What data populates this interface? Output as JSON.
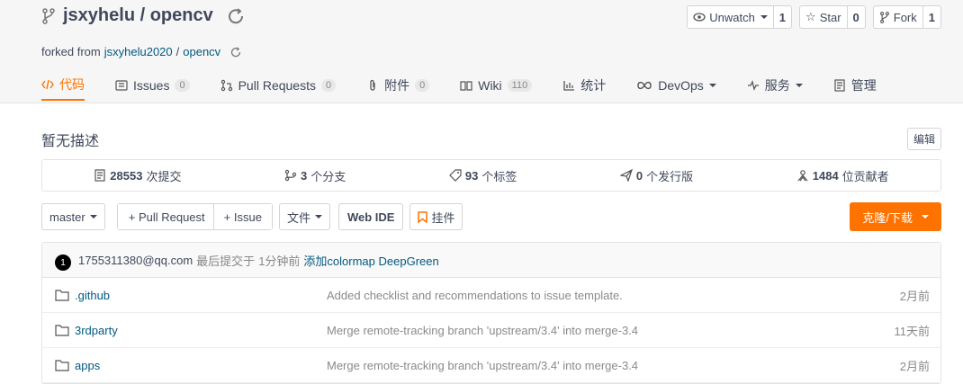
{
  "repo": {
    "title": "jsxyhelu / opencv",
    "forked_prefix": "forked from",
    "forked_owner": "jsxyhelu2020",
    "forked_sep": "/",
    "forked_repo": "opencv"
  },
  "actions": {
    "watch_label": "Unwatch",
    "watch_count": "1",
    "star_label": "Star",
    "star_count": "0",
    "fork_label": "Fork",
    "fork_count": "1"
  },
  "tabs": [
    {
      "label": "代码",
      "count": null
    },
    {
      "label": "Issues",
      "count": "0"
    },
    {
      "label": "Pull Requests",
      "count": "0"
    },
    {
      "label": "附件",
      "count": "0"
    },
    {
      "label": "Wiki",
      "count": "110"
    },
    {
      "label": "统计",
      "count": null
    },
    {
      "label": "DevOps",
      "count": null
    },
    {
      "label": "服务",
      "count": null
    },
    {
      "label": "管理",
      "count": null
    }
  ],
  "description": "暂无描述",
  "edit_label": "编辑",
  "stats": {
    "commits_num": "28553",
    "commits_label": "次提交",
    "branches_num": "3",
    "branches_label": "个分支",
    "tags_num": "93",
    "tags_label": "个标签",
    "releases_num": "0",
    "releases_label": "个发行版",
    "contributors_num": "1484",
    "contributors_label": "位贡献者"
  },
  "toolbar": {
    "branch": "master",
    "pull_request": "+ Pull Request",
    "issue": "+ Issue",
    "file": "文件",
    "webide": "Web IDE",
    "pin": "挂件",
    "clone": "克隆/下载"
  },
  "commit": {
    "avatar_text": "1",
    "author": "1755311380@qq.com",
    "prefix": "最后提交于",
    "time": "1分钟前",
    "message": "添加colormap DeepGreen"
  },
  "files": [
    {
      "name": ".github",
      "message": "Added checklist and recommendations to issue template.",
      "time": "2月前"
    },
    {
      "name": "3rdparty",
      "message": "Merge remote-tracking branch 'upstream/3.4' into merge-3.4",
      "time": "11天前"
    },
    {
      "name": "apps",
      "message": "Merge remote-tracking branch 'upstream/3.4' into merge-3.4",
      "time": "2月前"
    }
  ],
  "colors": {
    "accent": "#fe7300",
    "link": "#005980",
    "text": "#40485b"
  }
}
